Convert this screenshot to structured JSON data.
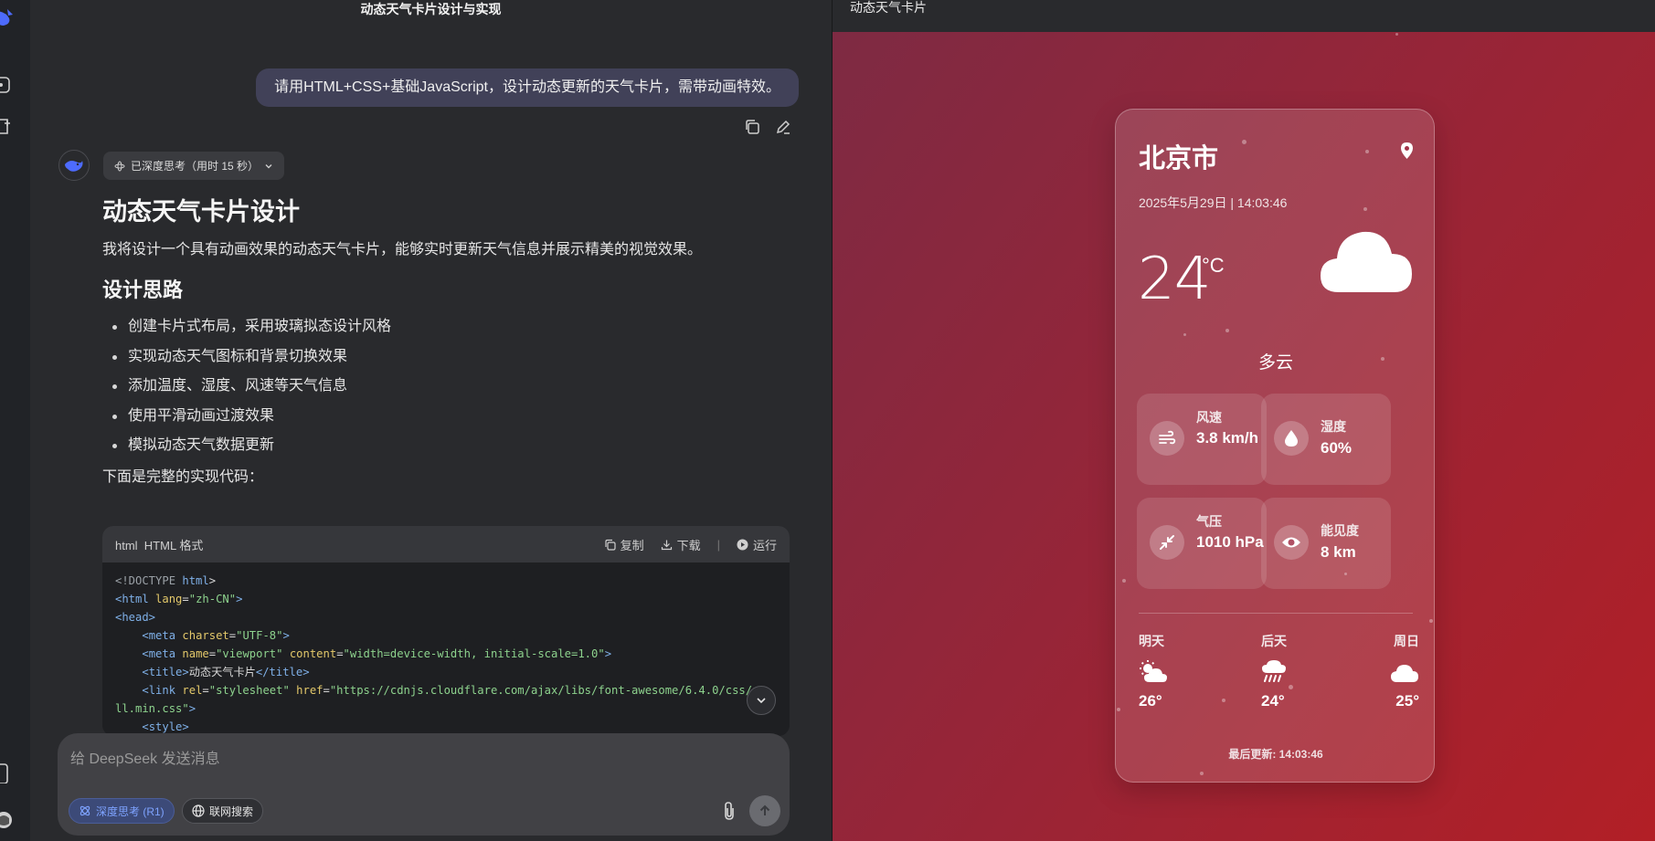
{
  "chat": {
    "title": "动态天气卡片设计与实现",
    "user_message": "请用HTML+CSS+基础JavaScript，设计动态更新的天气卡片，需带动画特效。",
    "thinking_label": "已深度思考（用时 15 秒）",
    "answer": {
      "h1": "动态天气卡片设计",
      "intro": "我将设计一个具有动画效果的动态天气卡片，能够实时更新天气信息并展示精美的视觉效果。",
      "h2": "设计思路",
      "bullets": [
        "创建卡片式布局，采用玻璃拟态设计风格",
        "实现动态天气图标和背景切换效果",
        "添加温度、湿度、风速等天气信息",
        "使用平滑动画过渡效果",
        "模拟动态天气数据更新"
      ],
      "outro": "下面是完整的实现代码："
    },
    "code": {
      "lang": "html",
      "format": "HTML 格式",
      "copy": "复制",
      "download": "下载",
      "run": "运行",
      "lines": [
        [
          [
            "tk-dt",
            "<!DOCTYPE "
          ],
          [
            "tk-tag",
            "html"
          ],
          [
            "",
            "> "
          ]
        ],
        [
          [
            "tk-tag",
            "<html "
          ],
          [
            "tk-attr",
            "lang"
          ],
          [
            "",
            "="
          ],
          [
            "tk-str",
            "\"zh-CN\""
          ],
          [
            "tk-tag",
            ">"
          ]
        ],
        [
          [
            "tk-tag",
            "<head>"
          ]
        ],
        [
          [
            "",
            "    "
          ],
          [
            "tk-tag",
            "<meta "
          ],
          [
            "tk-attr",
            "charset"
          ],
          [
            "",
            "="
          ],
          [
            "tk-str",
            "\"UTF-8\""
          ],
          [
            "tk-tag",
            ">"
          ]
        ],
        [
          [
            "",
            "    "
          ],
          [
            "tk-tag",
            "<meta "
          ],
          [
            "tk-attr",
            "name"
          ],
          [
            "",
            "="
          ],
          [
            "tk-str",
            "\"viewport\" "
          ],
          [
            "tk-attr",
            "content"
          ],
          [
            "",
            "="
          ],
          [
            "tk-str",
            "\"width=device-width, initial-scale=1.0\""
          ],
          [
            "tk-tag",
            ">"
          ]
        ],
        [
          [
            "",
            "    "
          ],
          [
            "tk-tag",
            "<title>"
          ],
          [
            "",
            "动态天气卡片"
          ],
          [
            "tk-tag",
            "</title>"
          ]
        ],
        [
          [
            "",
            "    "
          ],
          [
            "tk-tag",
            "<link "
          ],
          [
            "tk-attr",
            "rel"
          ],
          [
            "",
            "="
          ],
          [
            "tk-str",
            "\"stylesheet\" "
          ],
          [
            "tk-attr",
            "href"
          ],
          [
            "",
            "="
          ],
          [
            "tk-str",
            "\"https://cdnjs.cloudflare.com/ajax/libs/font-awesome/6.4.0/css/a"
          ]
        ],
        [
          [
            "tk-str",
            "ll.min.css\""
          ],
          [
            "tk-tag",
            ">"
          ]
        ],
        [
          [
            "",
            "    "
          ],
          [
            "tk-tag",
            "<style>"
          ]
        ]
      ]
    },
    "input_placeholder": "给 DeepSeek 发送消息",
    "deep_think_label": "深度思考 (R1)",
    "web_search_label": "联网搜索"
  },
  "preview": {
    "title": "动态天气卡片",
    "city": "北京市",
    "datetime": "2025年5月29日 | 14:03:46",
    "temperature": "24",
    "unit": "°C",
    "condition": "多云",
    "condition_icon": "cloud-icon",
    "stats": [
      {
        "label": "风速",
        "value": "3.8 km/h",
        "icon": "wind-icon"
      },
      {
        "label": "湿度",
        "value": "60%",
        "icon": "droplet-icon"
      },
      {
        "label": "气压",
        "value": "1010 hPa",
        "icon": "compress-icon"
      },
      {
        "label": "能见度",
        "value": "8 km",
        "icon": "eye-icon"
      }
    ],
    "forecast": [
      {
        "day": "明天",
        "temp": "26°",
        "icon": "cloud-sun-icon"
      },
      {
        "day": "后天",
        "temp": "24°",
        "icon": "cloud-rain-icon"
      },
      {
        "day": "周日",
        "temp": "25°",
        "icon": "cloud-icon"
      }
    ],
    "updated": "最后更新: 14:03:46",
    "colors": {
      "bg_start": "#7e2a43",
      "bg_end": "#b21f26",
      "accent": "#4d6bfe"
    }
  }
}
